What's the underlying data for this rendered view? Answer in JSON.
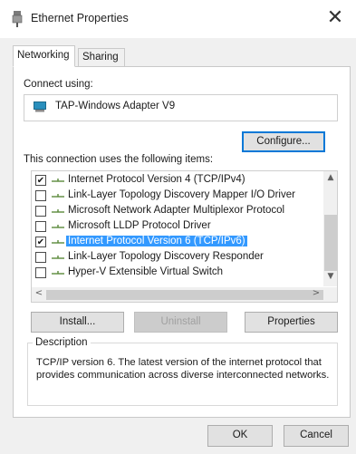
{
  "window": {
    "title": "Ethernet Properties",
    "close_glyph": "✕"
  },
  "tabs": [
    {
      "label": "Networking",
      "active": true
    },
    {
      "label": "Sharing",
      "active": false
    }
  ],
  "connect": {
    "label": "Connect using:",
    "adapter": "TAP-Windows Adapter V9",
    "configure_label": "Configure..."
  },
  "items": {
    "label": "This connection uses the following items:",
    "list": [
      {
        "label": "Internet Protocol Version 4 (TCP/IPv4)",
        "checked": "✔"
      },
      {
        "label": "Link-Layer Topology Discovery Mapper I/O Driver",
        "checked": ""
      },
      {
        "label": "Microsoft Network Adapter Multiplexor Protocol",
        "checked": ""
      },
      {
        "label": "Microsoft LLDP Protocol Driver",
        "checked": ""
      },
      {
        "label": "Internet Protocol Version 6 (TCP/IPv6)",
        "checked": "✔"
      },
      {
        "label": "Link-Layer Topology Discovery Responder",
        "checked": ""
      },
      {
        "label": "Hyper-V Extensible Virtual Switch",
        "checked": ""
      }
    ],
    "selected_index": 4
  },
  "scroll": {
    "up": "▲",
    "down": "▼",
    "left": "<",
    "right": ">"
  },
  "buttons": {
    "install": "Install...",
    "uninstall": "Uninstall",
    "properties": "Properties",
    "ok": "OK",
    "cancel": "Cancel"
  },
  "description": {
    "legend": "Description",
    "text": "TCP/IP version 6. The latest version of the internet protocol that provides communication across diverse interconnected networks."
  },
  "colors": {
    "selection": "#3399ff",
    "focus_border": "#0078d7",
    "adapter_icon": "#2a8fbd"
  },
  "icons": {
    "title": "ethernet-plug-icon",
    "adapter": "network-adapter-icon",
    "list_item": "network-component-icon"
  }
}
